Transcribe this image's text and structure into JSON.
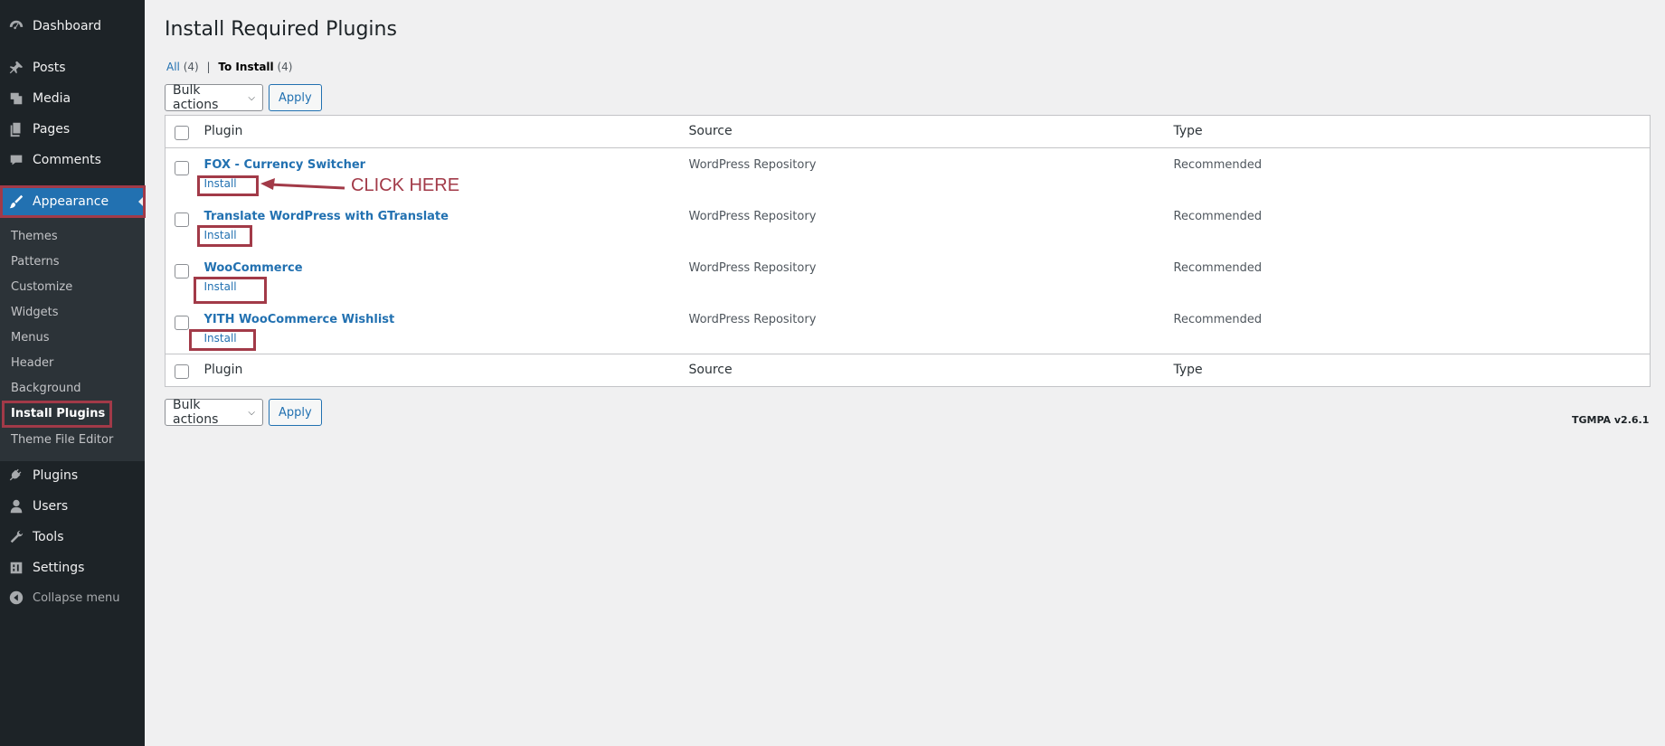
{
  "sidebar": {
    "items": [
      {
        "label": "Dashboard",
        "icon": "dashboard-icon"
      },
      {
        "label": "Posts",
        "icon": "pushpin-icon"
      },
      {
        "label": "Media",
        "icon": "media-icon"
      },
      {
        "label": "Pages",
        "icon": "pages-icon"
      },
      {
        "label": "Comments",
        "icon": "comment-icon"
      },
      {
        "label": "Appearance",
        "icon": "paintbrush-icon",
        "current": true
      },
      {
        "label": "Plugins",
        "icon": "plug-icon"
      },
      {
        "label": "Users",
        "icon": "user-icon"
      },
      {
        "label": "Tools",
        "icon": "wrench-icon"
      },
      {
        "label": "Settings",
        "icon": "settings-icon"
      }
    ],
    "submenu": [
      "Themes",
      "Patterns",
      "Customize",
      "Widgets",
      "Menus",
      "Header",
      "Background",
      "Install Plugins",
      "Theme File Editor"
    ],
    "collapse_label": "Collapse menu"
  },
  "page": {
    "title": "Install Required Plugins",
    "filters": {
      "all_label": "All",
      "all_count": "(4)",
      "to_install_label": "To Install",
      "to_install_count": "(4)",
      "separator": "|"
    },
    "bulk_actions_label": "Bulk actions",
    "apply_label": "Apply",
    "columns": {
      "plugin": "Plugin",
      "source": "Source",
      "type": "Type"
    },
    "rows": [
      {
        "name": "FOX - Currency Switcher",
        "action": "Install",
        "source": "WordPress Repository",
        "type": "Recommended"
      },
      {
        "name": "Translate WordPress with GTranslate",
        "action": "Install",
        "source": "WordPress Repository",
        "type": "Recommended"
      },
      {
        "name": "WooCommerce",
        "action": "Install",
        "source": "WordPress Repository",
        "type": "Recommended"
      },
      {
        "name": "YITH WooCommerce Wishlist",
        "action": "Install",
        "source": "WordPress Repository",
        "type": "Recommended"
      }
    ],
    "version": "TGMPA v2.6.1"
  },
  "annotation": {
    "text": "CLICK HERE",
    "color": "#a23a48"
  },
  "colors": {
    "sidebar_bg": "#1d2327",
    "accent": "#2271b1",
    "highlight": "#a23a48"
  }
}
